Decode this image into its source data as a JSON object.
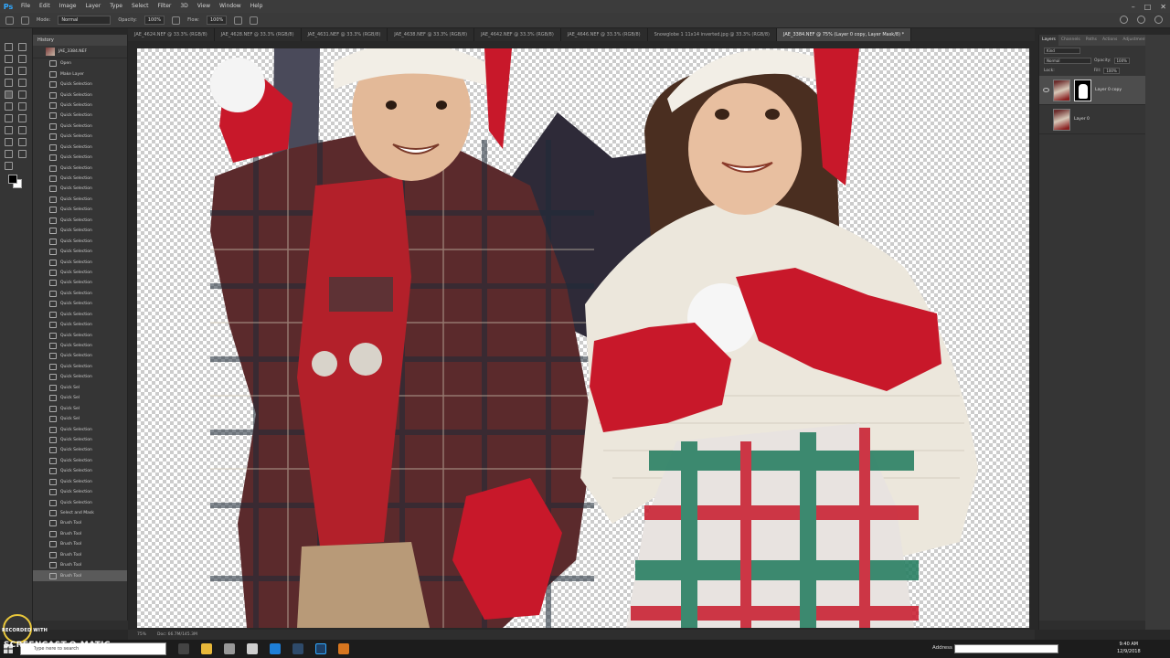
{
  "app": {
    "logo": "Ps"
  },
  "menubar": {
    "items": [
      "File",
      "Edit",
      "Image",
      "Layer",
      "Type",
      "Select",
      "Filter",
      "3D",
      "View",
      "Window",
      "Help"
    ]
  },
  "options": {
    "mode_label": "Mode:",
    "mode_value": "Normal",
    "opacity_label": "Opacity:",
    "opacity_value": "100%",
    "flow_label": "Flow:",
    "flow_value": "100%"
  },
  "history": {
    "tab": "History",
    "snapshot_name": "JAE_3384.NEF",
    "items": [
      "Open",
      "Make Layer",
      "Quick Selection",
      "Quick Selection",
      "Quick Selection",
      "Quick Selection",
      "Quick Selection",
      "Quick Selection",
      "Quick Selection",
      "Quick Selection",
      "Quick Selection",
      "Quick Selection",
      "Quick Selection",
      "Quick Selection",
      "Quick Selection",
      "Quick Selection",
      "Quick Selection",
      "Quick Selection",
      "Quick Selection",
      "Quick Selection",
      "Quick Selection",
      "Quick Selection",
      "Quick Selection",
      "Quick Selection",
      "Quick Selection",
      "Quick Selection",
      "Quick Selection",
      "Quick Selection",
      "Quick Selection",
      "Quick Selection",
      "Quick Selection",
      "Quick Sel",
      "Quick Sel",
      "Quick Sel",
      "Quick Sel",
      "Quick Selection",
      "Quick Selection",
      "Quick Selection",
      "Quick Selection",
      "Quick Selection",
      "Quick Selection",
      "Quick Selection",
      "Quick Selection",
      "Select and Mask",
      "Brush Tool",
      "Brush Tool",
      "Brush Tool",
      "Brush Tool",
      "Brush Tool",
      "Brush Tool"
    ],
    "active_index": 49
  },
  "doc_tabs": [
    {
      "label": "JAE_4624.NEF @ 33.3% (RGB/8)",
      "active": false
    },
    {
      "label": "JAE_4628.NEF @ 33.3% (RGB/8)",
      "active": false
    },
    {
      "label": "JAE_4631.NEF @ 33.3% (RGB/8)",
      "active": false
    },
    {
      "label": "JAE_4638.NEF @ 33.3% (RGB/8)",
      "active": false
    },
    {
      "label": "JAE_4642.NEF @ 33.3% (RGB/8)",
      "active": false
    },
    {
      "label": "JAE_4646.NEF @ 33.3% (RGB/8)",
      "active": false
    },
    {
      "label": "Snowglobe 1 11x14 inverted.jpg @ 33.3% (RGB/8)",
      "active": false
    },
    {
      "label": "JAE_3384.NEF @ 75% (Layer 0 copy, Layer Mask/8) *",
      "active": true
    }
  ],
  "layers_panel": {
    "tabs": [
      "Layers",
      "Channels",
      "Paths",
      "Actions",
      "Adjustments"
    ],
    "filter_value": "Kind",
    "blend_value": "Normal",
    "opacity_label": "Opacity:",
    "opacity_value": "100%",
    "lock_label": "Lock:",
    "fill_label": "Fill:",
    "fill_value": "100%",
    "layers": [
      {
        "name": "Layer 0 copy",
        "has_mask": true,
        "visible": true,
        "selected": true
      },
      {
        "name": "Layer 0",
        "has_mask": false,
        "visible": false,
        "selected": false
      }
    ]
  },
  "statusbar": {
    "zoom": "75%",
    "doc": "Doc: 66.7M/145.3M"
  },
  "taskbar": {
    "search_placeholder": "Type here to search",
    "address_label": "Address",
    "time": "9:40 AM",
    "date": "12/9/2018"
  },
  "watermark": {
    "recorded": "RECORDED WITH",
    "brand": "SCREENCAST-O-MATIC"
  },
  "colors": {
    "accent": "#31a8ff",
    "mitten_red": "#c8182a",
    "shirt_red": "#b3202a",
    "poncho": "#ece7dc",
    "skin": "#e3b998"
  }
}
